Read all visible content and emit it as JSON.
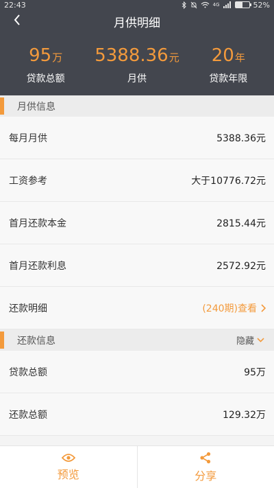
{
  "status_bar": {
    "time": "22:43",
    "network": "4G",
    "battery_text": "52%",
    "battery_level": 0.52
  },
  "nav": {
    "title": "月供明细",
    "back_icon": "chevron-left-icon"
  },
  "summary": [
    {
      "value": "95",
      "unit": "万",
      "label": "贷款总额"
    },
    {
      "value": "5388.36",
      "unit": "元",
      "label": "月供"
    },
    {
      "value": "20",
      "unit": "年",
      "label": "贷款年限"
    }
  ],
  "sections": {
    "monthly": {
      "title": "月供信息",
      "rows": [
        {
          "label": "每月月供",
          "value": "5388.36元"
        },
        {
          "label": "工资参考",
          "value": "大于10776.72元"
        },
        {
          "label": "首月还款本金",
          "value": "2815.44元"
        },
        {
          "label": "首月还款利息",
          "value": "2572.92元"
        }
      ],
      "detail": {
        "label": "还款明细",
        "link": "(240期)查看"
      }
    },
    "repayment": {
      "title": "还款信息",
      "toggle": "隐藏",
      "rows": [
        {
          "label": "贷款总额",
          "value": "95万"
        },
        {
          "label": "还款总额",
          "value": "129.32万"
        }
      ]
    }
  },
  "bottom": {
    "preview": {
      "label": "预览",
      "icon": "eye-icon"
    },
    "share": {
      "label": "分享",
      "icon": "share-icon"
    }
  },
  "colors": {
    "accent": "#f39a3c",
    "header_bg": "#43464e"
  }
}
